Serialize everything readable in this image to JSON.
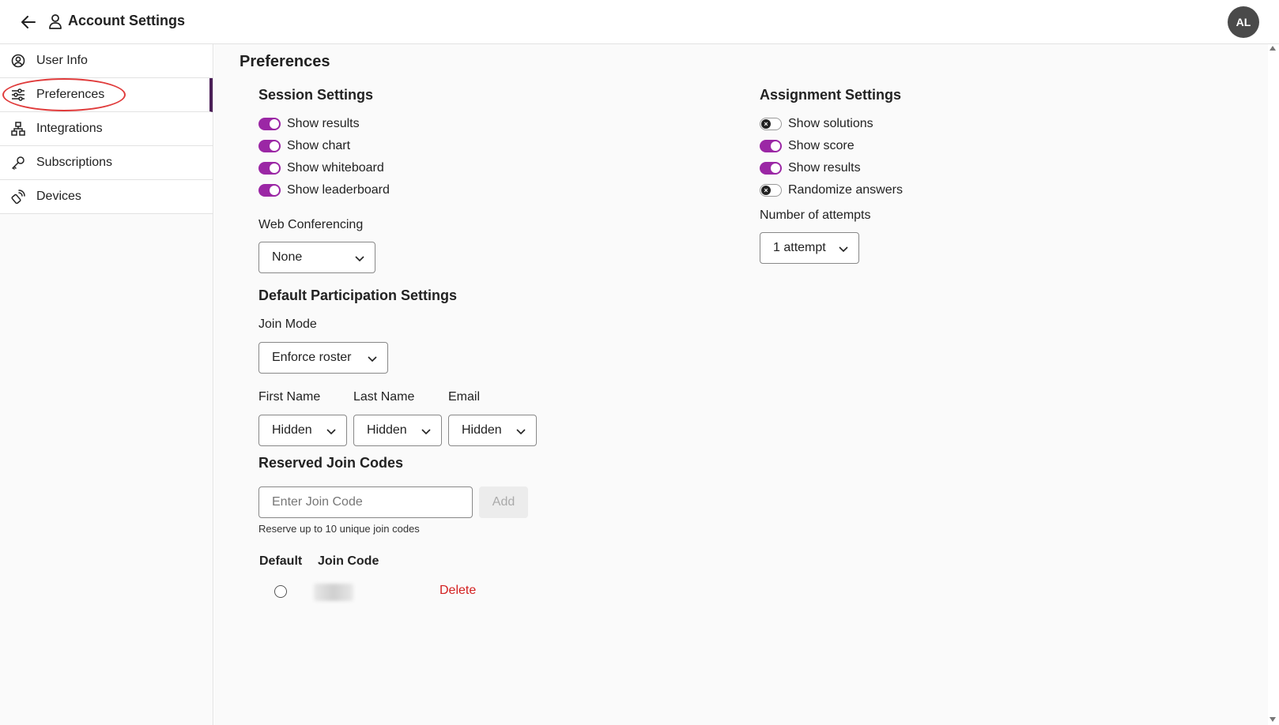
{
  "header": {
    "title": "Account Settings",
    "avatar_initials": "AL",
    "back_icon": "arrow-left-icon",
    "user_icon": "person-icon"
  },
  "sidebar": {
    "items": [
      {
        "label": "User Info",
        "icon": "user-circle-icon",
        "active": false
      },
      {
        "label": "Preferences",
        "icon": "sliders-icon",
        "active": true
      },
      {
        "label": "Integrations",
        "icon": "network-icon",
        "active": false
      },
      {
        "label": "Subscriptions",
        "icon": "key-icon",
        "active": false
      },
      {
        "label": "Devices",
        "icon": "remote-icon",
        "active": false
      }
    ]
  },
  "main": {
    "title": "Preferences",
    "session": {
      "title": "Session Settings",
      "toggles": [
        {
          "label": "Show results",
          "on": true
        },
        {
          "label": "Show chart",
          "on": true
        },
        {
          "label": "Show whiteboard",
          "on": true
        },
        {
          "label": "Show leaderboard",
          "on": true
        }
      ],
      "web_conf_label": "Web Conferencing",
      "web_conf_value": "None"
    },
    "assignment": {
      "title": "Assignment Settings",
      "toggles": [
        {
          "label": "Show solutions",
          "on": false
        },
        {
          "label": "Show score",
          "on": true
        },
        {
          "label": "Show results",
          "on": true
        },
        {
          "label": "Randomize answers",
          "on": false
        }
      ],
      "attempts_label": "Number of attempts",
      "attempts_value": "1 attempt"
    },
    "participation": {
      "title": "Default Participation Settings",
      "join_mode_label": "Join Mode",
      "join_mode_value": "Enforce roster",
      "first_name_label": "First Name",
      "first_name_value": "Hidden",
      "last_name_label": "Last Name",
      "last_name_value": "Hidden",
      "email_label": "Email",
      "email_value": "Hidden"
    },
    "join_codes": {
      "title": "Reserved Join Codes",
      "input_placeholder": "Enter Join Code",
      "add_label": "Add",
      "helper": "Reserve up to 10 unique join codes",
      "col_default": "Default",
      "col_join_code": "Join Code",
      "delete_label": "Delete"
    }
  },
  "colors": {
    "accent": "#9b27a5",
    "active_border": "#4b1f57",
    "delete": "#d32020",
    "highlight": "#e03b3b"
  }
}
